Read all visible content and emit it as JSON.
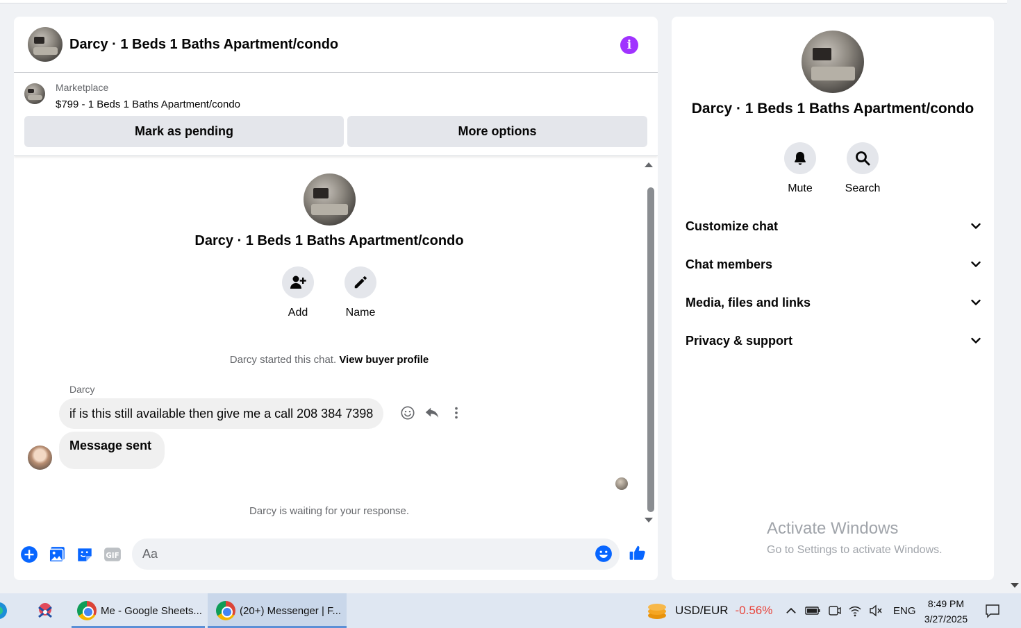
{
  "chat": {
    "header_title": "Darcy · 1 Beds 1 Baths Apartment/condo",
    "marketplace_label": "Marketplace",
    "listing": "$799 - 1 Beds 1 Baths Apartment/condo",
    "mark_pending": "Mark as pending",
    "more_options": "More options",
    "intro_title": "Darcy · 1 Beds 1 Baths Apartment/condo",
    "add_label": "Add",
    "name_label": "Name",
    "started_text": "Darcy started this chat.",
    "view_buyer": "View buyer profile",
    "sender": "Darcy",
    "message_1": "if is this still available then give me a call 208 384 7398",
    "message_2": "Message sent",
    "waiting": "Darcy is waiting for your response.",
    "composer_placeholder": "Aa"
  },
  "info_panel": {
    "title": "Darcy · 1 Beds 1 Baths Apartment/condo",
    "mute": "Mute",
    "search": "Search",
    "rows": [
      {
        "label": "Customize chat"
      },
      {
        "label": "Chat members"
      },
      {
        "label": "Media, files and links"
      },
      {
        "label": "Privacy & support"
      }
    ]
  },
  "watermark": {
    "line1": "Activate Windows",
    "line2": "Go to Settings to activate Windows."
  },
  "taskbar": {
    "sheets_tab": "Me - Google Sheets...",
    "messenger_tab": "(20+) Messenger | F...",
    "currency": "USD/EUR",
    "currency_change": "-0.56%",
    "language": "ENG",
    "time": "8:49 PM",
    "date": "3/27/2025"
  },
  "colors": {
    "accent": "#0866ff",
    "info": "#a033ff",
    "negative": "#e8453c"
  }
}
